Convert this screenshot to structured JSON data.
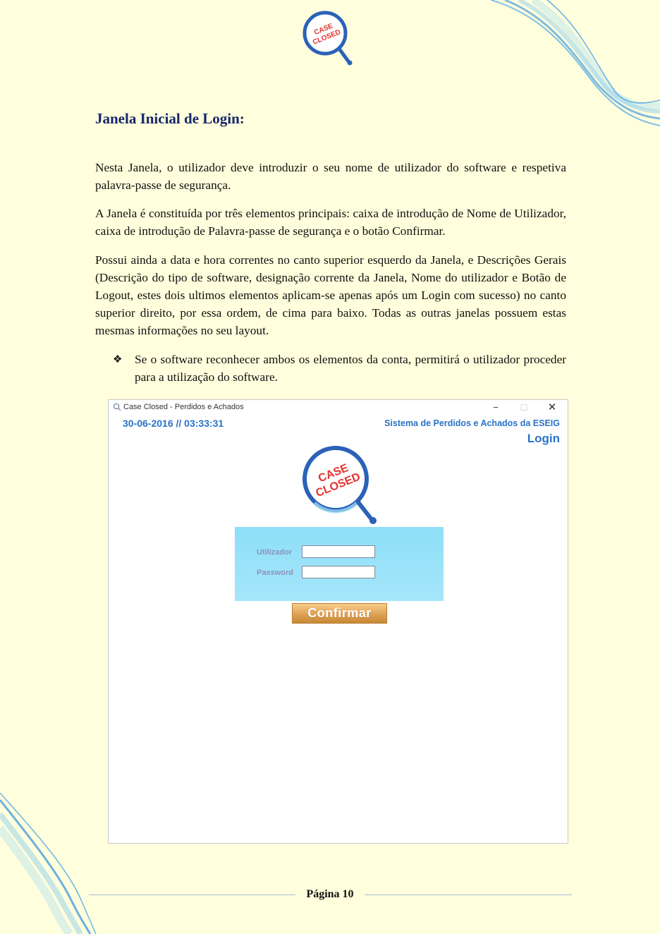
{
  "header": {
    "logo_text_line1": "CASE",
    "logo_text_line2": "CLOSED"
  },
  "section_title": "Janela Inicial de Login:",
  "paragraphs": [
    "Nesta Janela, o utilizador deve introduzir o seu nome de utilizador do software e respetiva palavra-passe de segurança.",
    "A Janela é constituída por três elementos principais: caixa de introdução de Nome de Utilizador, caixa de introdução de Palavra-passe de segurança e o botão Confirmar.",
    "Possui ainda a data e hora correntes no canto superior esquerdo da Janela, e Descrições Gerais (Descrição do tipo de software, designação corrente da Janela, Nome do utilizador e Botão de Logout, estes dois ultimos elementos aplicam-se apenas após um Login com sucesso) no canto superior direito, por essa ordem, de cima para baixo. Todas as outras janelas possuem estas mesmas informações no seu layout."
  ],
  "bullet": {
    "marker": "❖",
    "text": "Se o software reconhecer ambos os elementos da conta, permitirá o utilizador proceder para a utilização do software."
  },
  "app": {
    "window_title": "Case Closed - Perdidos e Achados",
    "minimize_symbol": "−",
    "maximize_symbol": "☐",
    "close_symbol": "✕",
    "datetime": "30-06-2016 // 03:33:31",
    "system_name": "Sistema de Perdidos e Achados da ESEIG",
    "window_name": "Login",
    "logo_text_line1": "CASE",
    "logo_text_line2": "CLOSED",
    "username_label": "Utilizador",
    "password_label": "Password",
    "username_value": "",
    "password_value": "",
    "confirm_label": "Confirmar"
  },
  "footer": {
    "page_label": "Página 10"
  },
  "colors": {
    "page_background": "#ffffdd",
    "title_color": "#17266b",
    "app_accent": "#2a73c7",
    "logo_ring": "#2b62b8",
    "logo_text": "#e2332f",
    "login_panel": "#a6e6fb",
    "confirm_button": "#dca155"
  },
  "icons": [
    "case-closed-logo-icon",
    "magnifier-app-icon",
    "minimize-icon",
    "maximize-icon",
    "close-icon",
    "bullet-diamond-icon"
  ]
}
